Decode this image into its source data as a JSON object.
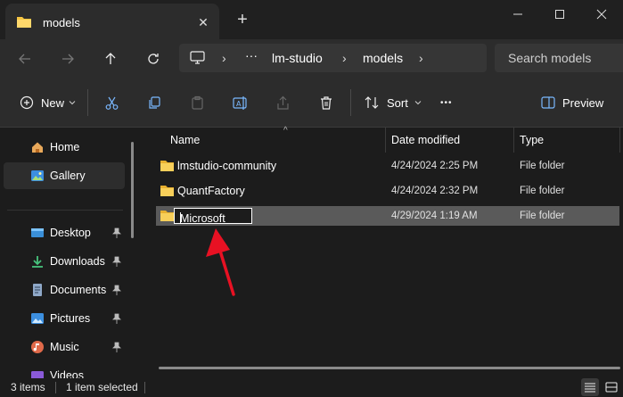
{
  "tab": {
    "title": "models"
  },
  "address": {
    "ellipsis": "···",
    "crumbs": [
      "lm-studio",
      "models"
    ],
    "search_placeholder": "Search models"
  },
  "commandbar": {
    "new_label": "New",
    "sort_label": "Sort",
    "more_label": "•••",
    "preview_label": "Preview"
  },
  "sidebar": {
    "items": [
      {
        "label": "Home",
        "icon": "home-icon"
      },
      {
        "label": "Gallery",
        "icon": "gallery-icon"
      },
      {
        "label": "Desktop",
        "icon": "desktop-icon"
      },
      {
        "label": "Downloads",
        "icon": "downloads-icon"
      },
      {
        "label": "Documents",
        "icon": "documents-icon"
      },
      {
        "label": "Pictures",
        "icon": "pictures-icon"
      },
      {
        "label": "Music",
        "icon": "music-icon"
      },
      {
        "label": "Videos",
        "icon": "videos-icon"
      }
    ]
  },
  "columns": {
    "name": "Name",
    "date": "Date modified",
    "type": "Type"
  },
  "files": [
    {
      "name": "lmstudio-community",
      "date": "4/24/2024 2:25 PM",
      "type": "File folder"
    },
    {
      "name": "QuantFactory",
      "date": "4/24/2024 2:32 PM",
      "type": "File folder"
    },
    {
      "name": "Microsoft",
      "date": "4/29/2024 1:19 AM",
      "type": "File folder"
    }
  ],
  "status": {
    "items": "3 items",
    "selected": "1 item selected"
  },
  "colors": {
    "folder": "#f5c542",
    "accent": "#e81123",
    "selected_row": "#5a5a5a"
  }
}
